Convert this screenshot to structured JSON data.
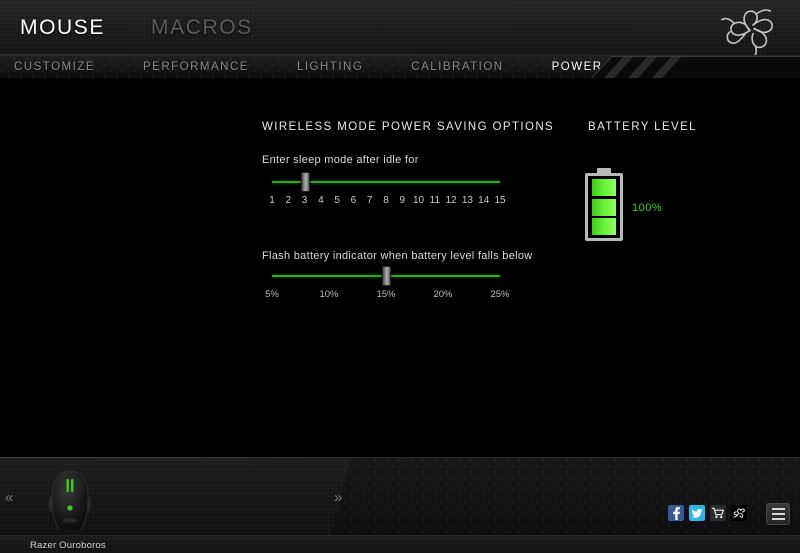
{
  "header": {
    "main_tabs": [
      {
        "label": "MOUSE",
        "active": true
      },
      {
        "label": "MACROS",
        "active": false
      }
    ],
    "logo_name": "razer-logo"
  },
  "subtabs": [
    {
      "label": "CUSTOMIZE",
      "active": false
    },
    {
      "label": "PERFORMANCE",
      "active": false
    },
    {
      "label": "LIGHTING",
      "active": false
    },
    {
      "label": "CALIBRATION",
      "active": false
    },
    {
      "label": "POWER",
      "active": true
    }
  ],
  "main": {
    "section_title": "WIRELESS MODE POWER SAVING OPTIONS",
    "sleep": {
      "label": "Enter sleep mode after idle for",
      "value": 3,
      "min": 1,
      "max": 15,
      "ticks": [
        "1",
        "2",
        "3",
        "4",
        "5",
        "6",
        "7",
        "8",
        "9",
        "10",
        "11",
        "12",
        "13",
        "14",
        "15"
      ]
    },
    "flash": {
      "label": "Flash battery indicator when battery level falls below",
      "value": "15%",
      "ticks": [
        "5%",
        "10%",
        "15%",
        "20%",
        "25%"
      ]
    },
    "battery": {
      "title": "BATTERY LEVEL",
      "percent_label": "100%",
      "segments": 3,
      "color": "#3cd21a"
    }
  },
  "devicebar": {
    "prev_arrow": "«",
    "next_arrow": "»",
    "device_name": "Razer Ouroboros"
  },
  "footer": {
    "social": [
      {
        "name": "facebook-icon"
      },
      {
        "name": "twitter-icon"
      },
      {
        "name": "cart-icon"
      },
      {
        "name": "razer-icon"
      }
    ],
    "menu_label": "menu"
  },
  "colors": {
    "accent_green": "#2faa1e",
    "battery_green": "#3cd21a",
    "active_text": "#ffffff",
    "inactive_text": "#5d5d5d"
  }
}
